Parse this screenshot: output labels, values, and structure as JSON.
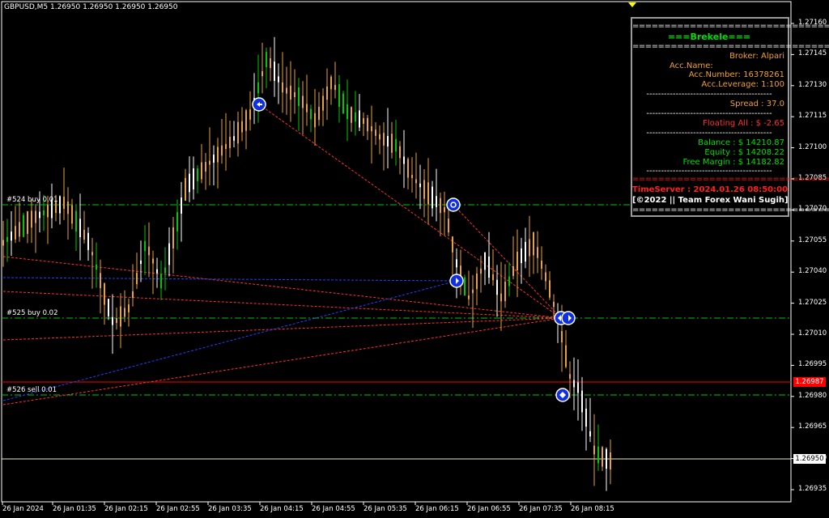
{
  "symbol_header": "GBPUSD,M5  1.26950 1.26950 1.26950 1.26950",
  "y_axis_ticks": [
    "1.27160",
    "1.27145",
    "1.27130",
    "1.27115",
    "1.27100",
    "1.27085",
    "1.27070",
    "1.27055",
    "1.27040",
    "1.27025",
    "1.27010",
    "1.26995",
    "1.26980",
    "1.26965",
    "1.26950",
    "1.26935"
  ],
  "x_axis_ticks": [
    "26 Jan 2024",
    "26 Jan 01:35",
    "26 Jan 02:15",
    "26 Jan 02:55",
    "26 Jan 03:35",
    "26 Jan 04:15",
    "26 Jan 04:55",
    "26 Jan 05:35",
    "26 Jan 06:15",
    "26 Jan 06:55",
    "26 Jan 07:35",
    "26 Jan 08:15"
  ],
  "price_markers": {
    "bid": "1.26950",
    "order": "1.26987"
  },
  "orders": [
    {
      "label": "#524 buy 0.01"
    },
    {
      "label": "#525 buy 0.02"
    },
    {
      "label": "#526 sell 0.01"
    }
  ],
  "panel": {
    "sep": "================================",
    "title": "===Brekele===",
    "broker": "Broker: Alpari",
    "acc_name": "Acc.Name:",
    "acc_number": "Acc.Number: 16378261",
    "acc_leverage": "Acc.Leverage: 1:100",
    "dash": "-------------------------------------------",
    "spread": "Spread :  37.0",
    "floating": "Floating All  : $ -2.65",
    "balance": "Balance  : $ 14210.87",
    "equity": "Equity  : $ 14208.22",
    "free_margin": "Free Margin : $ 14182.82",
    "time_server": "TimeServer : 2024.01.26 08:50:00",
    "copyright": "[©2022 || Team Forex Wani Sugih]"
  },
  "colors": {
    "bull": "#00c800",
    "bear": "#e8a23a",
    "doji": "#ffffff",
    "green_level": "#00c800",
    "red_trend": "#ff3030",
    "blue_trend": "#2040ff",
    "bid_line": "#e8e8c0",
    "order_line": "#ff0000"
  }
}
